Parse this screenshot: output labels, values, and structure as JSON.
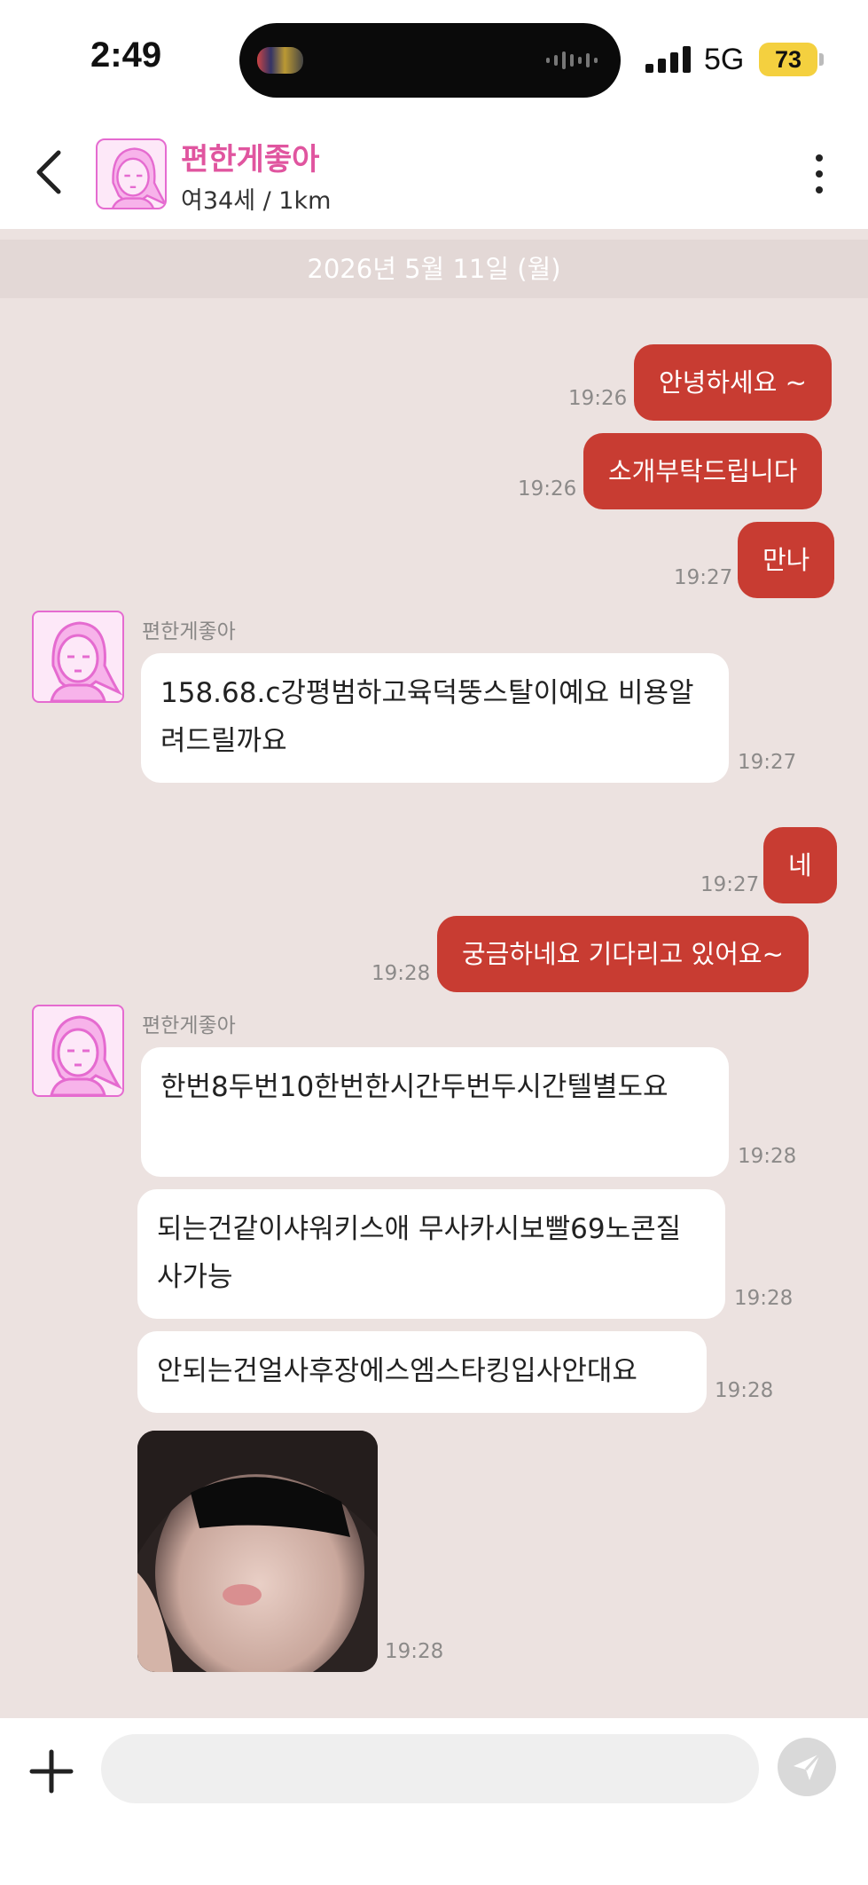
{
  "status_bar": {
    "time": "2:49",
    "network": "5G",
    "battery": "73"
  },
  "header": {
    "name": "편한게좋아",
    "sub": "여34세 / 1km"
  },
  "date_divider": "2026년 5월 11일 (월)",
  "messages": [
    {
      "dir": "out",
      "text": "안녕하세요 ~",
      "time": "19:26"
    },
    {
      "dir": "out",
      "text": "소개부탁드립니다",
      "time": "19:26"
    },
    {
      "dir": "out",
      "text": "만나",
      "time": "19:27"
    },
    {
      "dir": "in",
      "sender": "편한게좋아",
      "text": "158.68.c강평범하고육덕뚱스탈이예요 비용알려드릴까요",
      "time": "19:27"
    },
    {
      "dir": "out",
      "text": "네",
      "time": "19:27"
    },
    {
      "dir": "out",
      "text": "궁금하네요 기다리고 있어요~",
      "time": "19:28"
    },
    {
      "dir": "in",
      "sender": "편한게좋아",
      "text": "한번8두번10한번한시간두번두시간텔별도요",
      "time": "19:28"
    },
    {
      "dir": "in",
      "text": "되는건같이샤워키스애 무사카시보빨69노콘질사가능",
      "time": "19:28"
    },
    {
      "dir": "in",
      "text": "안되는건얼사후장에스엠스타킹입사안대요",
      "time": "19:28"
    },
    {
      "dir": "in",
      "type": "photo",
      "time": "19:28"
    }
  ],
  "input": {
    "placeholder": ""
  },
  "colors": {
    "outgoing": "#c83c32",
    "incoming": "#ffffff",
    "background": "#ece2e0",
    "accent_name": "#e0559f"
  },
  "icons": [
    "back-arrow-icon",
    "more-vertical-icon",
    "plus-icon",
    "send-icon",
    "avatar-icon"
  ]
}
